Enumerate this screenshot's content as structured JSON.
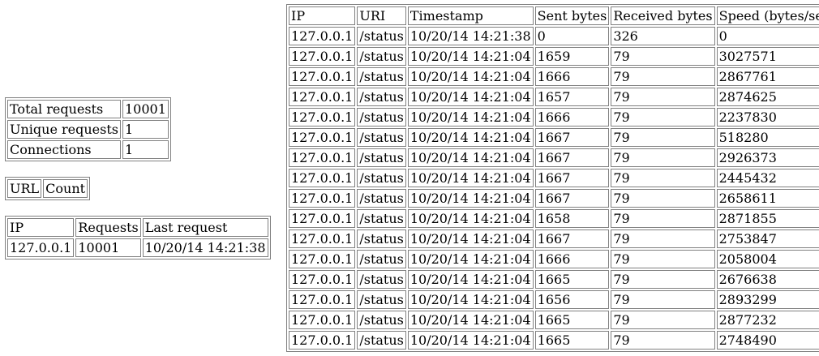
{
  "summary": {
    "rows": [
      {
        "label": "Total requests",
        "value": "10001"
      },
      {
        "label": "Unique requests",
        "value": "1"
      },
      {
        "label": "Connections",
        "value": "1"
      }
    ]
  },
  "url_table": {
    "headers": [
      "URL",
      "Count"
    ]
  },
  "ip_table": {
    "headers": [
      "IP",
      "Requests",
      "Last request"
    ],
    "rows": [
      [
        "127.0.0.1",
        "10001",
        "10/20/14 14:21:38"
      ]
    ]
  },
  "requests_table": {
    "headers": [
      "IP",
      "URI",
      "Timestamp",
      "Sent bytes",
      "Received bytes",
      "Speed (bytes/sec)"
    ],
    "rows": [
      [
        "127.0.0.1",
        "/status",
        "10/20/14 14:21:38",
        "0",
        "326",
        "0"
      ],
      [
        "127.0.0.1",
        "/status",
        "10/20/14 14:21:04",
        "1659",
        "79",
        "3027571"
      ],
      [
        "127.0.0.1",
        "/status",
        "10/20/14 14:21:04",
        "1666",
        "79",
        "2867761"
      ],
      [
        "127.0.0.1",
        "/status",
        "10/20/14 14:21:04",
        "1657",
        "79",
        "2874625"
      ],
      [
        "127.0.0.1",
        "/status",
        "10/20/14 14:21:04",
        "1666",
        "79",
        "2237830"
      ],
      [
        "127.0.0.1",
        "/status",
        "10/20/14 14:21:04",
        "1667",
        "79",
        "518280"
      ],
      [
        "127.0.0.1",
        "/status",
        "10/20/14 14:21:04",
        "1667",
        "79",
        "2926373"
      ],
      [
        "127.0.0.1",
        "/status",
        "10/20/14 14:21:04",
        "1667",
        "79",
        "2445432"
      ],
      [
        "127.0.0.1",
        "/status",
        "10/20/14 14:21:04",
        "1667",
        "79",
        "2658611"
      ],
      [
        "127.0.0.1",
        "/status",
        "10/20/14 14:21:04",
        "1658",
        "79",
        "2871855"
      ],
      [
        "127.0.0.1",
        "/status",
        "10/20/14 14:21:04",
        "1667",
        "79",
        "2753847"
      ],
      [
        "127.0.0.1",
        "/status",
        "10/20/14 14:21:04",
        "1666",
        "79",
        "2058004"
      ],
      [
        "127.0.0.1",
        "/status",
        "10/20/14 14:21:04",
        "1665",
        "79",
        "2676638"
      ],
      [
        "127.0.0.1",
        "/status",
        "10/20/14 14:21:04",
        "1656",
        "79",
        "2893299"
      ],
      [
        "127.0.0.1",
        "/status",
        "10/20/14 14:21:04",
        "1665",
        "79",
        "2877232"
      ],
      [
        "127.0.0.1",
        "/status",
        "10/20/14 14:21:04",
        "1665",
        "79",
        "2748490"
      ]
    ]
  }
}
